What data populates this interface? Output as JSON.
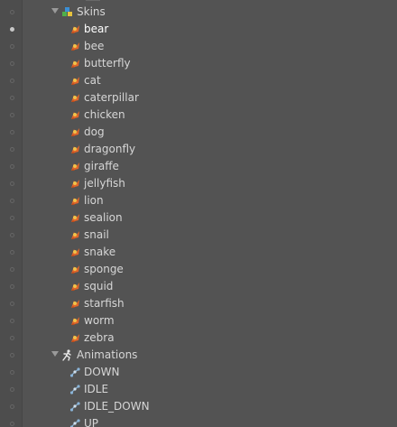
{
  "tree": {
    "skins_folder": {
      "label": "Skins",
      "icon": "skins-folder-icon"
    },
    "skins": [
      {
        "label": "bear",
        "icon": "skin-icon",
        "selected": true
      },
      {
        "label": "bee",
        "icon": "skin-icon"
      },
      {
        "label": "butterfly",
        "icon": "skin-icon"
      },
      {
        "label": "cat",
        "icon": "skin-icon"
      },
      {
        "label": "caterpillar",
        "icon": "skin-icon"
      },
      {
        "label": "chicken",
        "icon": "skin-icon"
      },
      {
        "label": "dog",
        "icon": "skin-icon"
      },
      {
        "label": "dragonfly",
        "icon": "skin-icon"
      },
      {
        "label": "giraffe",
        "icon": "skin-icon"
      },
      {
        "label": "jellyfish",
        "icon": "skin-icon"
      },
      {
        "label": "lion",
        "icon": "skin-icon"
      },
      {
        "label": "sealion",
        "icon": "skin-icon"
      },
      {
        "label": "snail",
        "icon": "skin-icon"
      },
      {
        "label": "snake",
        "icon": "skin-icon"
      },
      {
        "label": "sponge",
        "icon": "skin-icon"
      },
      {
        "label": "squid",
        "icon": "skin-icon"
      },
      {
        "label": "starfish",
        "icon": "skin-icon"
      },
      {
        "label": "worm",
        "icon": "skin-icon"
      },
      {
        "label": "zebra",
        "icon": "skin-icon"
      }
    ],
    "animations_folder": {
      "label": "Animations",
      "icon": "animations-folder-icon"
    },
    "animations": [
      {
        "label": "DOWN",
        "icon": "animation-icon"
      },
      {
        "label": "IDLE",
        "icon": "animation-icon"
      },
      {
        "label": "IDLE_DOWN",
        "icon": "animation-icon"
      },
      {
        "label": "UP",
        "icon": "animation-icon"
      }
    ]
  },
  "colors": {
    "background": "#535353",
    "text": "#d6d6d6",
    "skin_icon_orange": "#e0662a",
    "skin_icon_yellow": "#f0c24a"
  }
}
